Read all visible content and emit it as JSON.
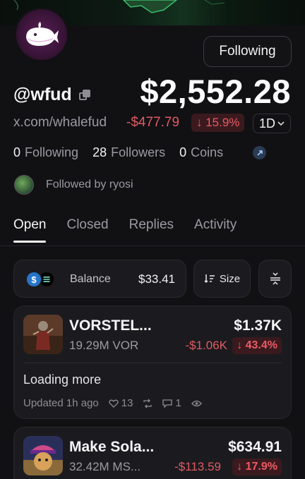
{
  "profile": {
    "handle": "@wfud",
    "url": "x.com/whalefud",
    "follow_button": "Following",
    "balance": "$2,552.28",
    "pnl": "-$477.79",
    "pnl_pct": "↓ 15.9%",
    "timeframe": "1D",
    "following_count": "0",
    "following_label": "Following",
    "followers_count": "28",
    "followers_label": "Followers",
    "coins_count": "0",
    "coins_label": "Coins",
    "followed_by": "Followed by ryosi"
  },
  "tabs": [
    {
      "label": "Open",
      "active": true
    },
    {
      "label": "Closed",
      "active": false
    },
    {
      "label": "Replies",
      "active": false
    },
    {
      "label": "Activity",
      "active": false
    }
  ],
  "balance_pill": {
    "label": "Balance",
    "value": "$33.41"
  },
  "sort_button": {
    "label": "Size"
  },
  "positions": [
    {
      "name": "VORSTEL...",
      "amount": "19.29M VOR",
      "value": "$1.37K",
      "pnl": "-$1.06K",
      "pct": "↓ 43.4%",
      "note": "Loading more",
      "updated": "Updated 1h ago",
      "likes": "13",
      "comments": "1"
    },
    {
      "name": "Make Sola...",
      "amount": "32.42M MS...",
      "value": "$634.91",
      "pnl": "-$113.59",
      "pct": "↓ 17.9%"
    }
  ],
  "colors": {
    "negative": "#e05a63",
    "negative_bg": "#3a1a1e",
    "background": "#111114",
    "card": "#1b1b1f"
  }
}
